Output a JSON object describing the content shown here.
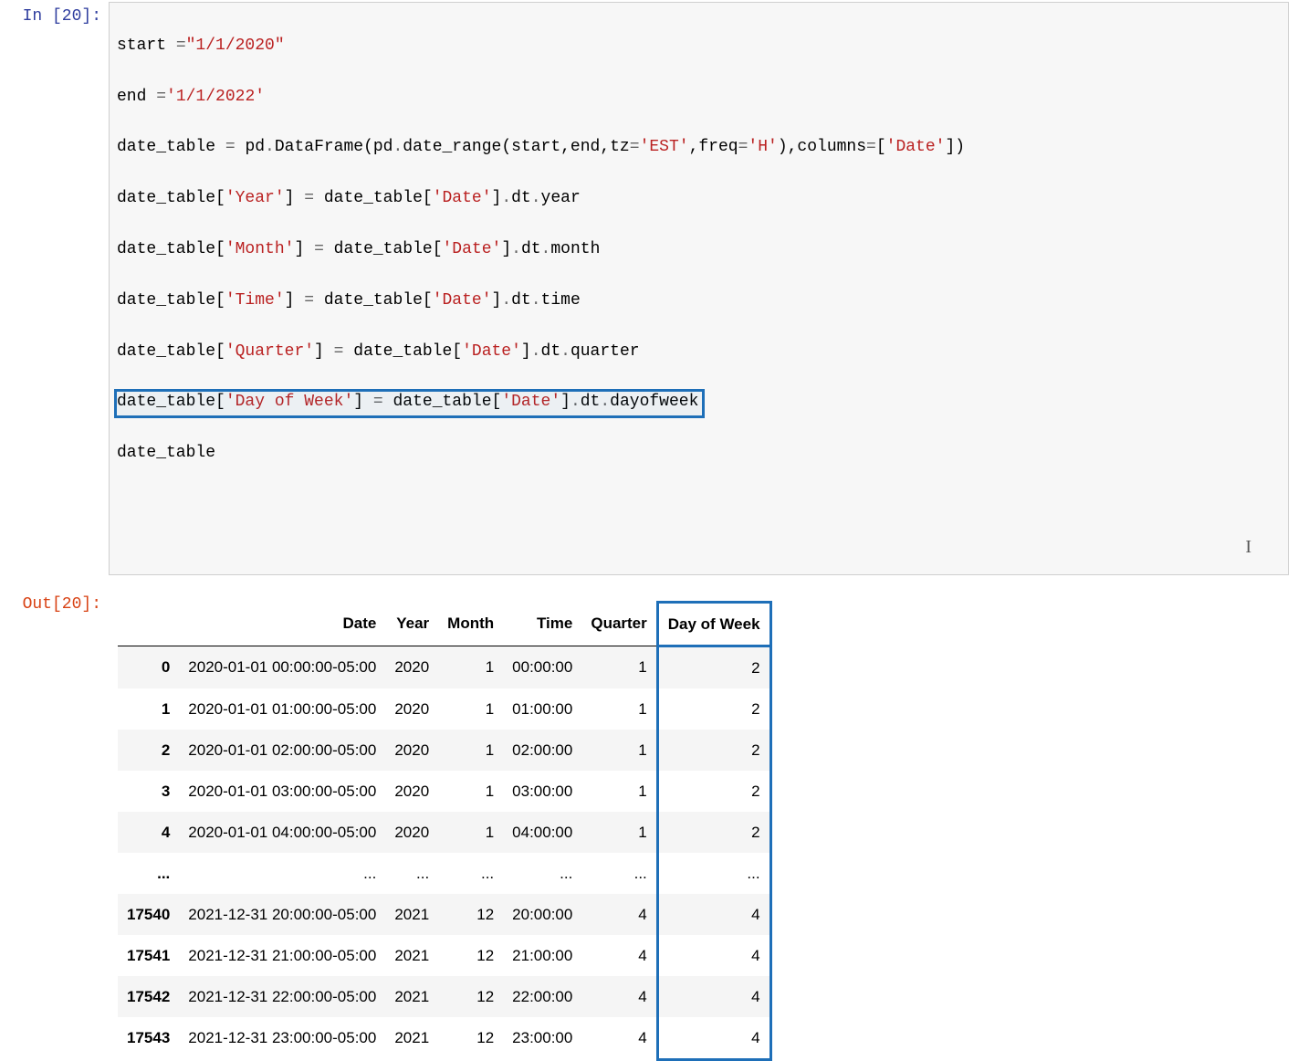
{
  "in_prompt": "In [20]:",
  "out_prompt": "Out[20]:",
  "code": {
    "l1_a": "start ",
    "l1_b": "=",
    "l1_c": "\"1/1/2020\"",
    "l2_a": "end ",
    "l2_b": "=",
    "l2_c": "'1/1/2022'",
    "l3_a": "date_table ",
    "l3_b": "=",
    "l3_c": " pd",
    "l3_d": ".",
    "l3_e": "DataFrame(pd",
    "l3_f": ".",
    "l3_g": "date_range(start,end,tz",
    "l3_h": "=",
    "l3_i": "'EST'",
    "l3_j": ",freq",
    "l3_k": "=",
    "l3_l": "'H'",
    "l3_m": "),columns",
    "l3_n": "=",
    "l3_o": "[",
    "l3_p": "'Date'",
    "l3_q": "])",
    "l4_a": "date_table[",
    "l4_b": "'Year'",
    "l4_c": "] ",
    "l4_d": "=",
    "l4_e": " date_table[",
    "l4_f": "'Date'",
    "l4_g": "]",
    "l4_h": ".",
    "l4_i": "dt",
    "l4_j": ".",
    "l4_k": "year",
    "l5_a": "date_table[",
    "l5_b": "'Month'",
    "l5_c": "] ",
    "l5_d": "=",
    "l5_e": " date_table[",
    "l5_f": "'Date'",
    "l5_g": "]",
    "l5_h": ".",
    "l5_i": "dt",
    "l5_j": ".",
    "l5_k": "month",
    "l6_a": "date_table[",
    "l6_b": "'Time'",
    "l6_c": "] ",
    "l6_d": "=",
    "l6_e": " date_table[",
    "l6_f": "'Date'",
    "l6_g": "]",
    "l6_h": ".",
    "l6_i": "dt",
    "l6_j": ".",
    "l6_k": "time",
    "l7_a": "date_table[",
    "l7_b": "'Quarter'",
    "l7_c": "] ",
    "l7_d": "=",
    "l7_e": " date_table[",
    "l7_f": "'Date'",
    "l7_g": "]",
    "l7_h": ".",
    "l7_i": "dt",
    "l7_j": ".",
    "l7_k": "quarter",
    "l8_a": "date_table[",
    "l8_b": "'Day of Week'",
    "l8_c": "] ",
    "l8_d": "=",
    "l8_e": " date_table[",
    "l8_f": "'Date'",
    "l8_g": "]",
    "l8_h": ".",
    "l8_i": "dt",
    "l8_j": ".",
    "l8_k": "dayofweek",
    "l9": "date_table"
  },
  "table": {
    "headers": [
      "",
      "Date",
      "Year",
      "Month",
      "Time",
      "Quarter",
      "Day of Week"
    ],
    "rows": [
      {
        "idx": "0",
        "date": "2020-01-01 00:00:00-05:00",
        "year": "2020",
        "month": "1",
        "time": "00:00:00",
        "quarter": "1",
        "dow": "2"
      },
      {
        "idx": "1",
        "date": "2020-01-01 01:00:00-05:00",
        "year": "2020",
        "month": "1",
        "time": "01:00:00",
        "quarter": "1",
        "dow": "2"
      },
      {
        "idx": "2",
        "date": "2020-01-01 02:00:00-05:00",
        "year": "2020",
        "month": "1",
        "time": "02:00:00",
        "quarter": "1",
        "dow": "2"
      },
      {
        "idx": "3",
        "date": "2020-01-01 03:00:00-05:00",
        "year": "2020",
        "month": "1",
        "time": "03:00:00",
        "quarter": "1",
        "dow": "2"
      },
      {
        "idx": "4",
        "date": "2020-01-01 04:00:00-05:00",
        "year": "2020",
        "month": "1",
        "time": "04:00:00",
        "quarter": "1",
        "dow": "2"
      },
      {
        "idx": "...",
        "date": "...",
        "year": "...",
        "month": "...",
        "time": "...",
        "quarter": "...",
        "dow": "..."
      },
      {
        "idx": "17540",
        "date": "2021-12-31 20:00:00-05:00",
        "year": "2021",
        "month": "12",
        "time": "20:00:00",
        "quarter": "4",
        "dow": "4"
      },
      {
        "idx": "17541",
        "date": "2021-12-31 21:00:00-05:00",
        "year": "2021",
        "month": "12",
        "time": "21:00:00",
        "quarter": "4",
        "dow": "4"
      },
      {
        "idx": "17542",
        "date": "2021-12-31 22:00:00-05:00",
        "year": "2021",
        "month": "12",
        "time": "22:00:00",
        "quarter": "4",
        "dow": "4"
      },
      {
        "idx": "17543",
        "date": "2021-12-31 23:00:00-05:00",
        "year": "2021",
        "month": "12",
        "time": "23:00:00",
        "quarter": "4",
        "dow": "4"
      }
    ]
  }
}
